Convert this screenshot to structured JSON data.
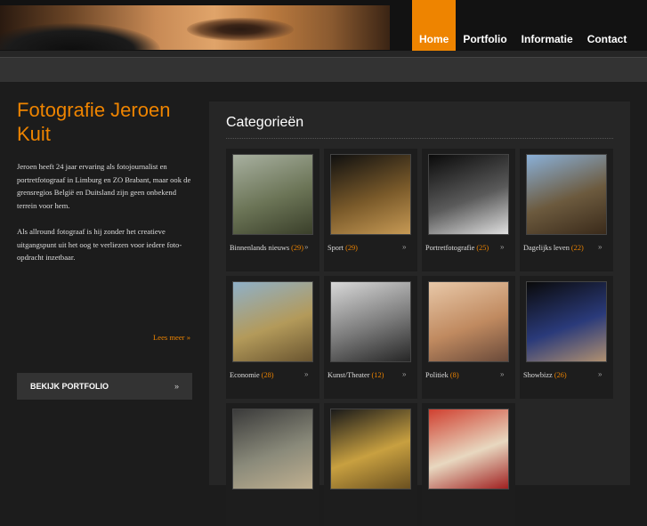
{
  "nav": {
    "items": [
      {
        "label": "Home",
        "active": true
      },
      {
        "label": "Portfolio",
        "active": false
      },
      {
        "label": "Informatie",
        "active": false
      },
      {
        "label": "Contact",
        "active": false
      }
    ]
  },
  "intro": {
    "title": "Fotografie Jeroen Kuit",
    "paragraph1": "Jeroen heeft 24 jaar ervaring als fotojournalist en portretfotograaf in Limburg en ZO Brabant, maar ook de grensregios België en Duitsland zijn geen onbekend terrein voor hem.",
    "paragraph2": "Als allround fotograaf is hij zonder het creatieve uitgangspunt uit het oog te verliezen voor iedere foto-opdracht inzetbaar.",
    "read_more": "Lees meer »",
    "portfolio_button": "BEKIJK PORTFOLIO",
    "portfolio_arrow": "»"
  },
  "categories": {
    "heading": "Categorieën",
    "arrow": "»",
    "items": [
      {
        "name": "Binnenlands nieuws",
        "count": "(29)",
        "colors": [
          "#a8b0a0",
          "#6b7456",
          "#3a3f2a"
        ]
      },
      {
        "name": "Sport",
        "count": "(29)",
        "colors": [
          "#101010",
          "#7a5a2a",
          "#c79a55"
        ]
      },
      {
        "name": "Portretfotografie",
        "count": "(25)",
        "colors": [
          "#0a0a0a",
          "#5a5a5a",
          "#e0e0e0"
        ]
      },
      {
        "name": "Dagelijks leven",
        "count": "(22)",
        "colors": [
          "#8ab0d8",
          "#6c5a3e",
          "#3a2a1a"
        ]
      },
      {
        "name": "Economie",
        "count": "(28)",
        "colors": [
          "#8fb0c8",
          "#b39a5a",
          "#6a5530"
        ]
      },
      {
        "name": "Kunst/Theater",
        "count": "(12)",
        "colors": [
          "#d8d8d8",
          "#7a7a7a",
          "#262626"
        ]
      },
      {
        "name": "Politiek",
        "count": "(8)",
        "colors": [
          "#e8c8a8",
          "#c08a60",
          "#6a4a3a"
        ]
      },
      {
        "name": "Showbizz",
        "count": "(26)",
        "colors": [
          "#0a0a0a",
          "#2a3a7a",
          "#b09070"
        ]
      },
      {
        "name": "",
        "count": "",
        "colors": [
          "#3a3a3a",
          "#8a8a7a",
          "#c0b090"
        ]
      },
      {
        "name": "",
        "count": "",
        "colors": [
          "#1a1a1a",
          "#c8a040",
          "#6a5020"
        ]
      },
      {
        "name": "",
        "count": "",
        "colors": [
          "#d04030",
          "#e8d8c0",
          "#a02020"
        ]
      }
    ]
  }
}
